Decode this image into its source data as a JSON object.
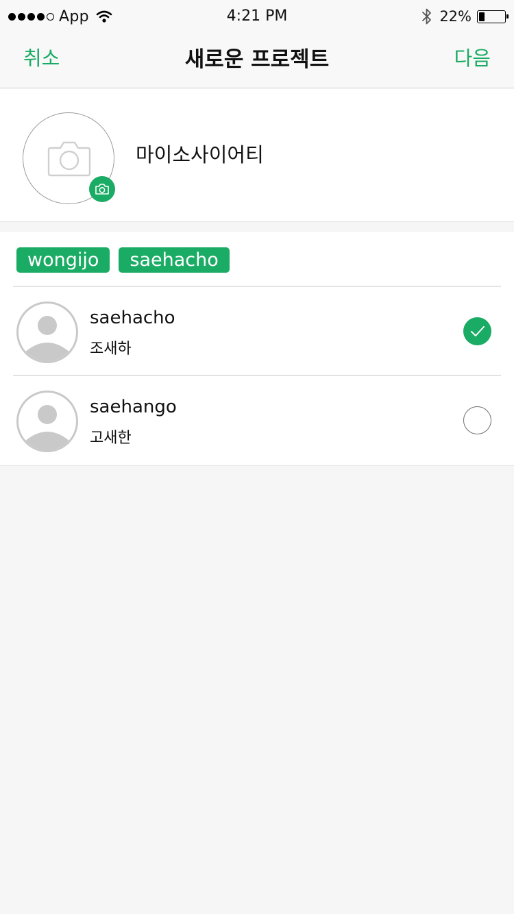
{
  "status_bar": {
    "carrier": "App",
    "time": "4:21 PM",
    "battery_percent": "22%",
    "battery_level": 0.22,
    "signal_bars": 4,
    "signal_total": 5,
    "icons": [
      "wifi-icon",
      "bluetooth-icon",
      "battery-icon"
    ]
  },
  "nav": {
    "cancel_label": "취소",
    "title": "새로운 프로젝트",
    "next_label": "다음"
  },
  "project": {
    "name": "마이소사이어티",
    "photo_icon": "camera-icon"
  },
  "selected_chips": [
    "wongijo",
    "saehacho"
  ],
  "members": [
    {
      "username": "saehacho",
      "name": "조새하",
      "selected": true
    },
    {
      "username": "saehango",
      "name": "고새한",
      "selected": false
    }
  ],
  "colors": {
    "accent": "#1aab64",
    "background": "#f6f6f6",
    "nav_background": "#f8f8f8"
  }
}
